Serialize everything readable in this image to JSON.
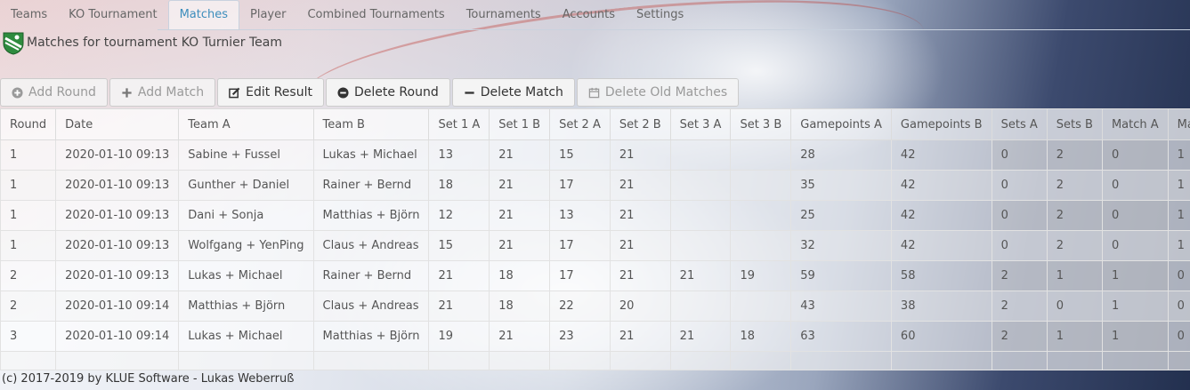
{
  "nav": [
    "Teams",
    "KO Tournament",
    "Matches",
    "Player",
    "Combined Tournaments",
    "Tournaments",
    "Accounts",
    "Settings"
  ],
  "nav_active": "Matches",
  "header": {
    "title": "Matches for tournament KO Turnier Team"
  },
  "toolbar": {
    "add_round": "Add Round",
    "add_match": "Add Match",
    "edit_result": "Edit Result",
    "delete_round": "Delete Round",
    "delete_match": "Delete Match",
    "delete_old": "Delete Old Matches"
  },
  "columns": [
    "Round",
    "Date",
    "Team A",
    "Team B",
    "Set 1 A",
    "Set 1 B",
    "Set 2 A",
    "Set 2 B",
    "Set 3 A",
    "Set 3 B",
    "Gamepoints A",
    "Gamepoints B",
    "Sets A",
    "Sets B",
    "Match A",
    "Match B"
  ],
  "rows": [
    {
      "round": "1",
      "date": "2020-01-10 09:13",
      "team_a": "Sabine + Fussel",
      "team_b": "Lukas + Michael",
      "s1a": "13",
      "s1b": "21",
      "s2a": "15",
      "s2b": "21",
      "s3a": "",
      "s3b": "",
      "ga": "28",
      "gb": "42",
      "sa": "0",
      "sb": "2",
      "ma": "0",
      "mb": "1",
      "winner": "b"
    },
    {
      "round": "1",
      "date": "2020-01-10 09:13",
      "team_a": "Gunther + Daniel",
      "team_b": "Rainer + Bernd",
      "s1a": "18",
      "s1b": "21",
      "s2a": "17",
      "s2b": "21",
      "s3a": "",
      "s3b": "",
      "ga": "35",
      "gb": "42",
      "sa": "0",
      "sb": "2",
      "ma": "0",
      "mb": "1",
      "winner": "b"
    },
    {
      "round": "1",
      "date": "2020-01-10 09:13",
      "team_a": "Dani + Sonja",
      "team_b": "Matthias + Björn",
      "s1a": "12",
      "s1b": "21",
      "s2a": "13",
      "s2b": "21",
      "s3a": "",
      "s3b": "",
      "ga": "25",
      "gb": "42",
      "sa": "0",
      "sb": "2",
      "ma": "0",
      "mb": "1",
      "winner": "b"
    },
    {
      "round": "1",
      "date": "2020-01-10 09:13",
      "team_a": "Wolfgang + YenPing",
      "team_b": "Claus + Andreas",
      "s1a": "15",
      "s1b": "21",
      "s2a": "17",
      "s2b": "21",
      "s3a": "",
      "s3b": "",
      "ga": "32",
      "gb": "42",
      "sa": "0",
      "sb": "2",
      "ma": "0",
      "mb": "1",
      "winner": "b"
    },
    {
      "round": "2",
      "date": "2020-01-10 09:13",
      "team_a": "Lukas + Michael",
      "team_b": "Rainer + Bernd",
      "s1a": "21",
      "s1b": "18",
      "s2a": "17",
      "s2b": "21",
      "s3a": "21",
      "s3b": "19",
      "ga": "59",
      "gb": "58",
      "sa": "2",
      "sb": "1",
      "ma": "1",
      "mb": "0",
      "winner": "a"
    },
    {
      "round": "2",
      "date": "2020-01-10 09:14",
      "team_a": "Matthias + Björn",
      "team_b": "Claus + Andreas",
      "s1a": "21",
      "s1b": "18",
      "s2a": "22",
      "s2b": "20",
      "s3a": "",
      "s3b": "",
      "ga": "43",
      "gb": "38",
      "sa": "2",
      "sb": "0",
      "ma": "1",
      "mb": "0",
      "winner": "a"
    },
    {
      "round": "3",
      "date": "2020-01-10 09:14",
      "team_a": "Lukas + Michael",
      "team_b": "Matthias + Björn",
      "s1a": "19",
      "s1b": "21",
      "s2a": "23",
      "s2b": "21",
      "s3a": "21",
      "s3b": "18",
      "ga": "63",
      "gb": "60",
      "sa": "2",
      "sb": "1",
      "ma": "1",
      "mb": "0",
      "winner": "a"
    }
  ],
  "footer": "(c) 2017-2019 by KLUE Software - Lukas Weberruß"
}
